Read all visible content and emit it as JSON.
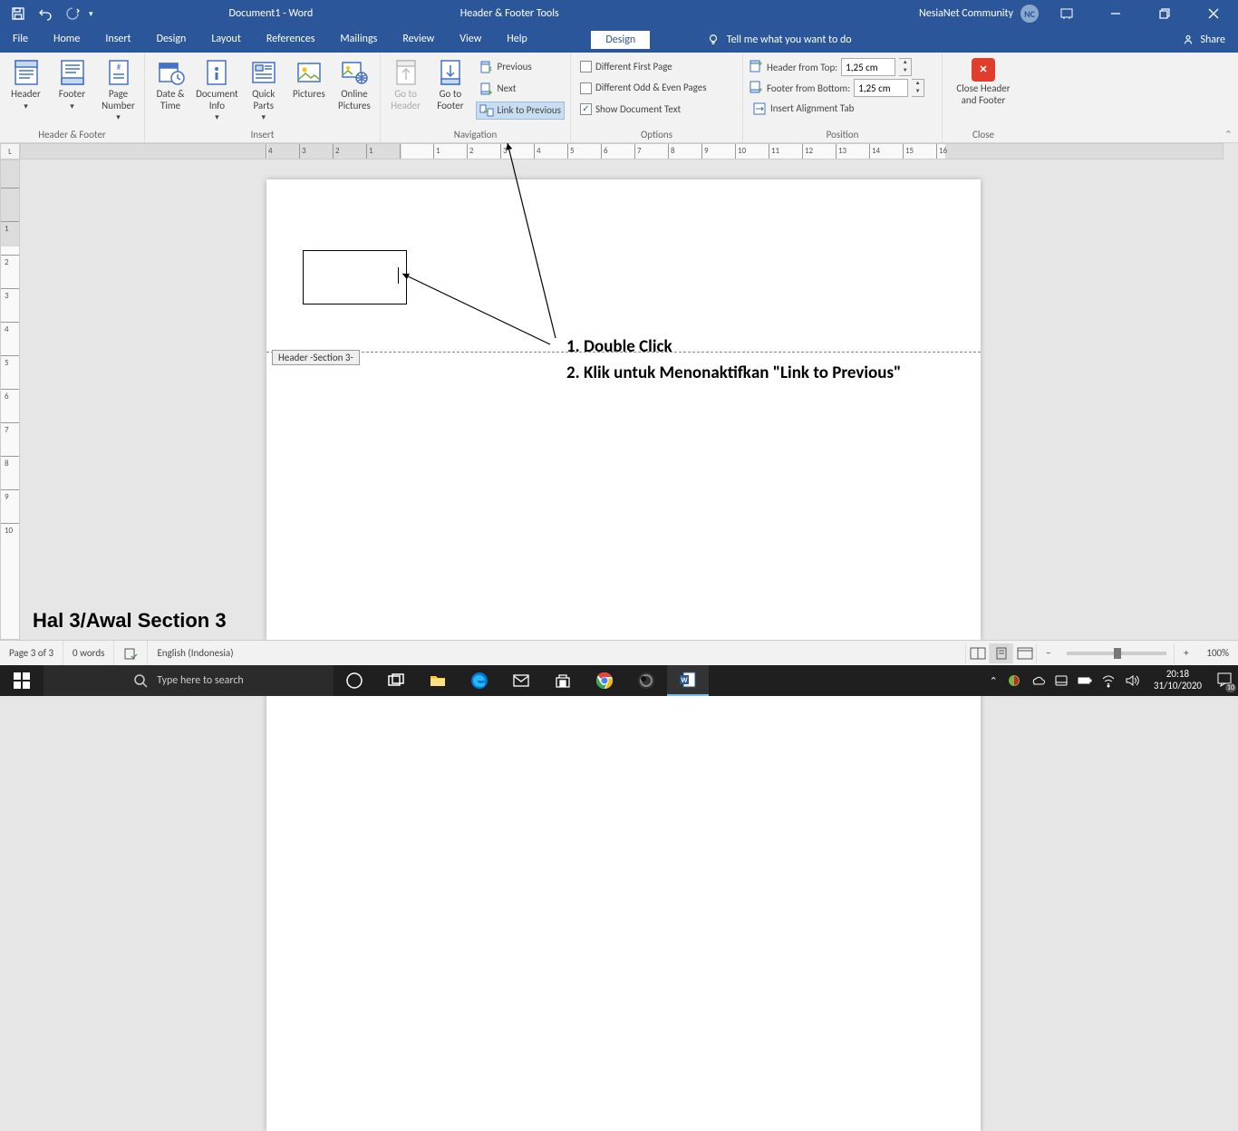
{
  "titlebar": {
    "doc_title": "Document1 - Word",
    "context_title": "Header & Footer Tools",
    "username": "NesiaNet Community",
    "avatar_initials": "NC"
  },
  "tabs": {
    "file": "File",
    "items": [
      "Home",
      "Insert",
      "Design",
      "Layout",
      "References",
      "Mailings",
      "Review",
      "View",
      "Help"
    ],
    "context_tab": "Design",
    "tell_me": "Tell me what you want to do",
    "share": "Share"
  },
  "ribbon": {
    "groups": {
      "header_footer": {
        "label": "Header & Footer",
        "header": "Header",
        "footer": "Footer",
        "page_number": "Page Number"
      },
      "insert": {
        "label": "Insert",
        "date_time": "Date & Time",
        "doc_info": "Document Info",
        "quick_parts": "Quick Parts",
        "pictures": "Pictures",
        "online_pictures": "Online Pictures"
      },
      "navigation": {
        "label": "Navigation",
        "goto_header": "Go to Header",
        "goto_footer": "Go to Footer",
        "previous": "Previous",
        "next": "Next",
        "link_prev": "Link to Previous"
      },
      "options": {
        "label": "Options",
        "diff_first": "Different First Page",
        "diff_odd_even": "Different Odd & Even Pages",
        "show_doc": "Show Document Text"
      },
      "position": {
        "label": "Position",
        "header_from_top": "Header from Top:",
        "footer_from_bottom": "Footer from Bottom:",
        "insert_align": "Insert Alignment Tab",
        "header_val": "1,25 cm",
        "footer_val": "1,25 cm"
      },
      "close": {
        "label": "Close",
        "close_btn": "Close Header and Footer"
      }
    }
  },
  "document": {
    "section_tag": "Header -Section 3-",
    "annotation_line1": "1. Double Click",
    "annotation_line2": "2. Klik untuk Menonaktifkan \"Link to Previous\"",
    "watermark": "Hal 3/Awal Section 3"
  },
  "statusbar": {
    "page": "Page 3 of 3",
    "words": "0 words",
    "language": "English (Indonesia)",
    "zoom": "100%"
  },
  "taskbar": {
    "search_placeholder": "Type here to search",
    "time": "20:18",
    "date": "31/10/2020",
    "notif_count": "10"
  },
  "ruler": {
    "h_labels": [
      "4",
      "3",
      "2",
      "1",
      "",
      "1",
      "2",
      "3",
      "4",
      "5",
      "6",
      "7",
      "8",
      "9",
      "10",
      "11",
      "12",
      "13",
      "14",
      "15",
      "16"
    ],
    "v_labels": [
      "",
      "1",
      "2",
      "3",
      "4",
      "5",
      "6",
      "7",
      "8",
      "9",
      "10"
    ]
  }
}
